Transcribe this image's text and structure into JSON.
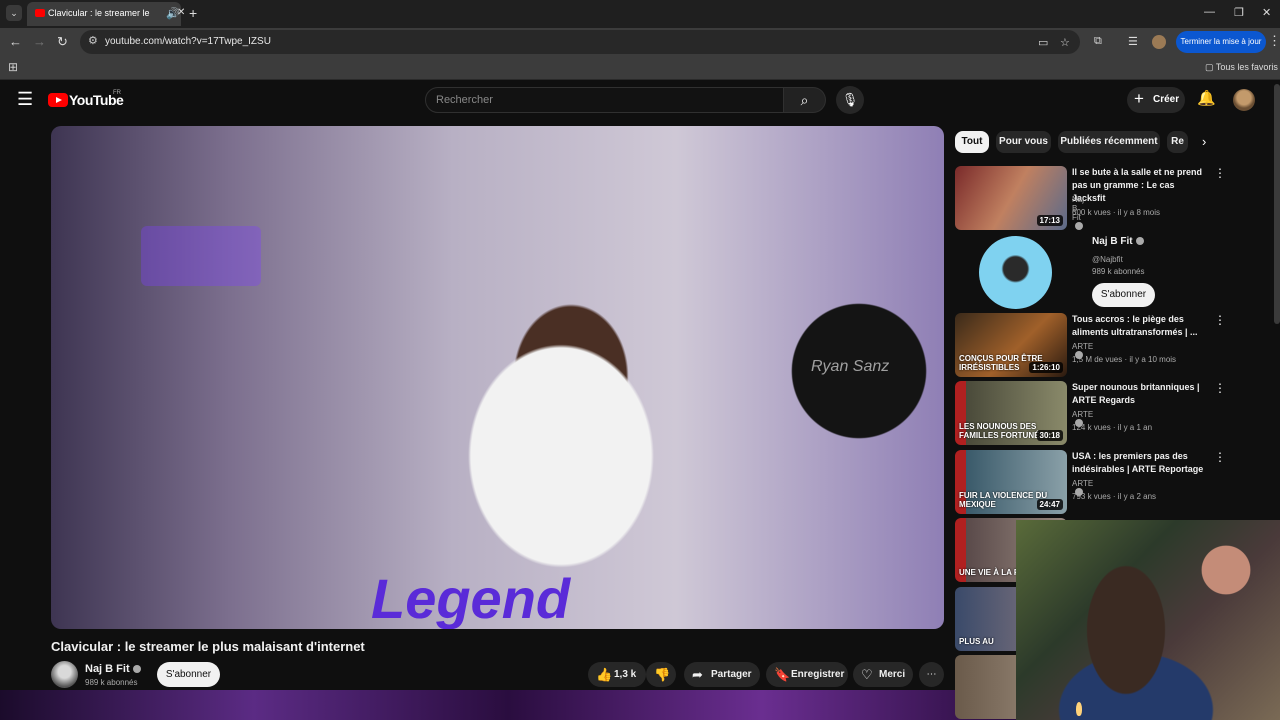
{
  "browser": {
    "tab_title": "Clavicular : le streamer le pl",
    "url": "youtube.com/watch?v=17Twpe_IZSU",
    "update_button": "Terminer la mise à jour",
    "bookmarks_folder": "Tous les favoris"
  },
  "header": {
    "logo": "YouTube",
    "country": "FR",
    "search_placeholder": "Rechercher",
    "create_label": "Créer"
  },
  "video": {
    "player_sign": "Ryan Sanz",
    "jersey_text": "Legend",
    "title": "Clavicular : le streamer le plus malaisant d'internet",
    "channel": "Naj B Fit",
    "subscribers": "989 k abonnés",
    "subscribe_label": "S'abonner",
    "likes": "1,3 k",
    "share_label": "Partager",
    "save_label": "Enregistrer",
    "thanks_label": "Merci"
  },
  "chips": [
    "Tout",
    "Pour vous",
    "Publiées récemment",
    "Re"
  ],
  "recommendations": [
    {
      "title": "Il se bute à la salle et ne prend pas un gramme : Le cas Jacksfit",
      "channel": "Naj B Fit",
      "meta": "600 k vues · il y a 8 mois",
      "duration": "17:13",
      "overlay": "",
      "thumb_color": "#7a2a2a"
    },
    {
      "title": "Tous accros : le piège des aliments ultratransformés | ...",
      "channel": "ARTE",
      "meta": "1,5 M de vues · il y a 10 mois",
      "duration": "1:26:10",
      "overlay": "CONÇUS POUR ÊTRE IRRÉSISTIBLES",
      "thumb_color": "#6b3a1a"
    },
    {
      "title": "Super nounous britanniques | ARTE Regards",
      "channel": "ARTE",
      "meta": "124 k vues · il y a 1 an",
      "duration": "30:18",
      "overlay": "LES NOUNOUS DES FAMILLES FORTUNÉES",
      "thumb_color": "#4a4a3a"
    },
    {
      "title": "USA : les premiers pas des indésirables | ARTE Reportage",
      "channel": "ARTE",
      "meta": "793 k vues · il y a 2 ans",
      "duration": "24:47",
      "overlay": "FUIR LA VIOLENCE DU MEXIQUE",
      "thumb_color": "#3a5a6a"
    },
    {
      "title": "",
      "channel": "",
      "meta": "",
      "duration": "",
      "overlay": "UNE VIE À LA FOI",
      "thumb_color": "#5a4a4a"
    },
    {
      "title": "",
      "channel": "",
      "meta": "",
      "duration": "",
      "overlay": "PLUS AU",
      "thumb_color": "#3a4a6a"
    },
    {
      "title": "",
      "channel": "",
      "meta": "",
      "duration": "",
      "overlay": "",
      "thumb_color": "#6a5a4a"
    }
  ],
  "channel_card": {
    "name": "Naj B Fit",
    "handle": "@Najbfit",
    "subscribers": "989 k abonnés",
    "subscribe_label": "S'abonner"
  }
}
